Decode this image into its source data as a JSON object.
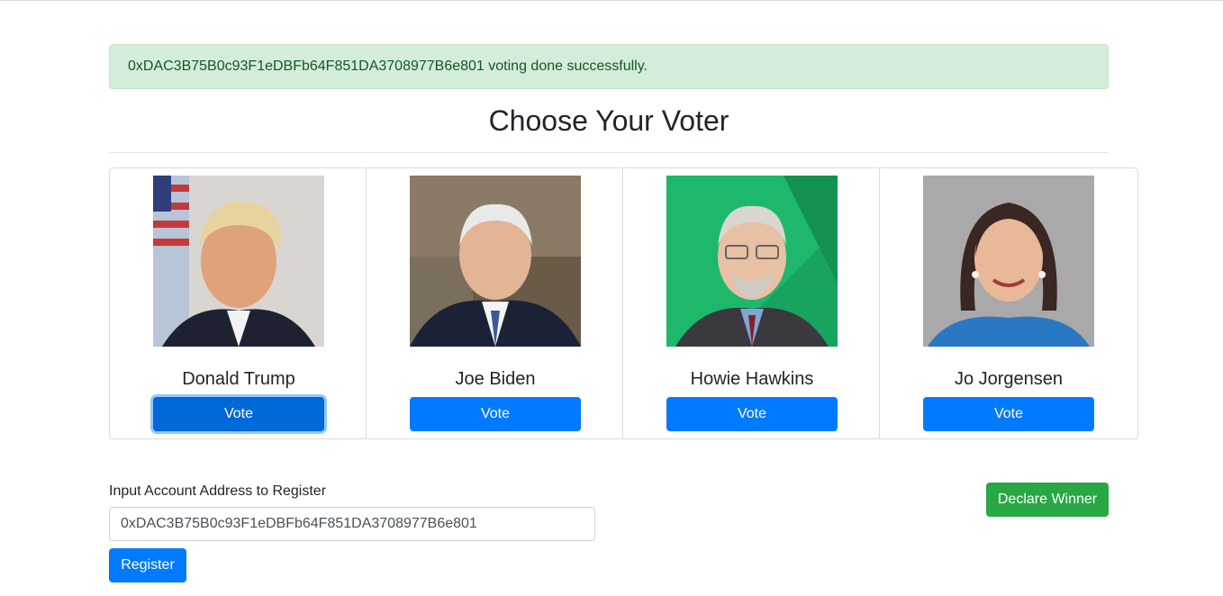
{
  "alert": {
    "message": "0xDAC3B75B0c93F1eDBFb64F851DA3708977B6e801 voting done successfully."
  },
  "heading": "Choose Your Voter",
  "candidates": [
    {
      "name": "Donald Trump",
      "vote_label": "Vote"
    },
    {
      "name": "Joe Biden",
      "vote_label": "Vote"
    },
    {
      "name": "Howie Hawkins",
      "vote_label": "Vote"
    },
    {
      "name": "Jo Jorgensen",
      "vote_label": "Vote"
    }
  ],
  "register": {
    "label": "Input Account Address to Register",
    "input_value": "0xDAC3B75B0c93F1eDBFb64F851DA3708977B6e801",
    "button_label": "Register"
  },
  "declare_winner_label": "Declare Winner",
  "colors": {
    "primary": "#007bff",
    "success": "#28a745",
    "alert_bg": "#d4edda",
    "alert_text": "#155724"
  }
}
